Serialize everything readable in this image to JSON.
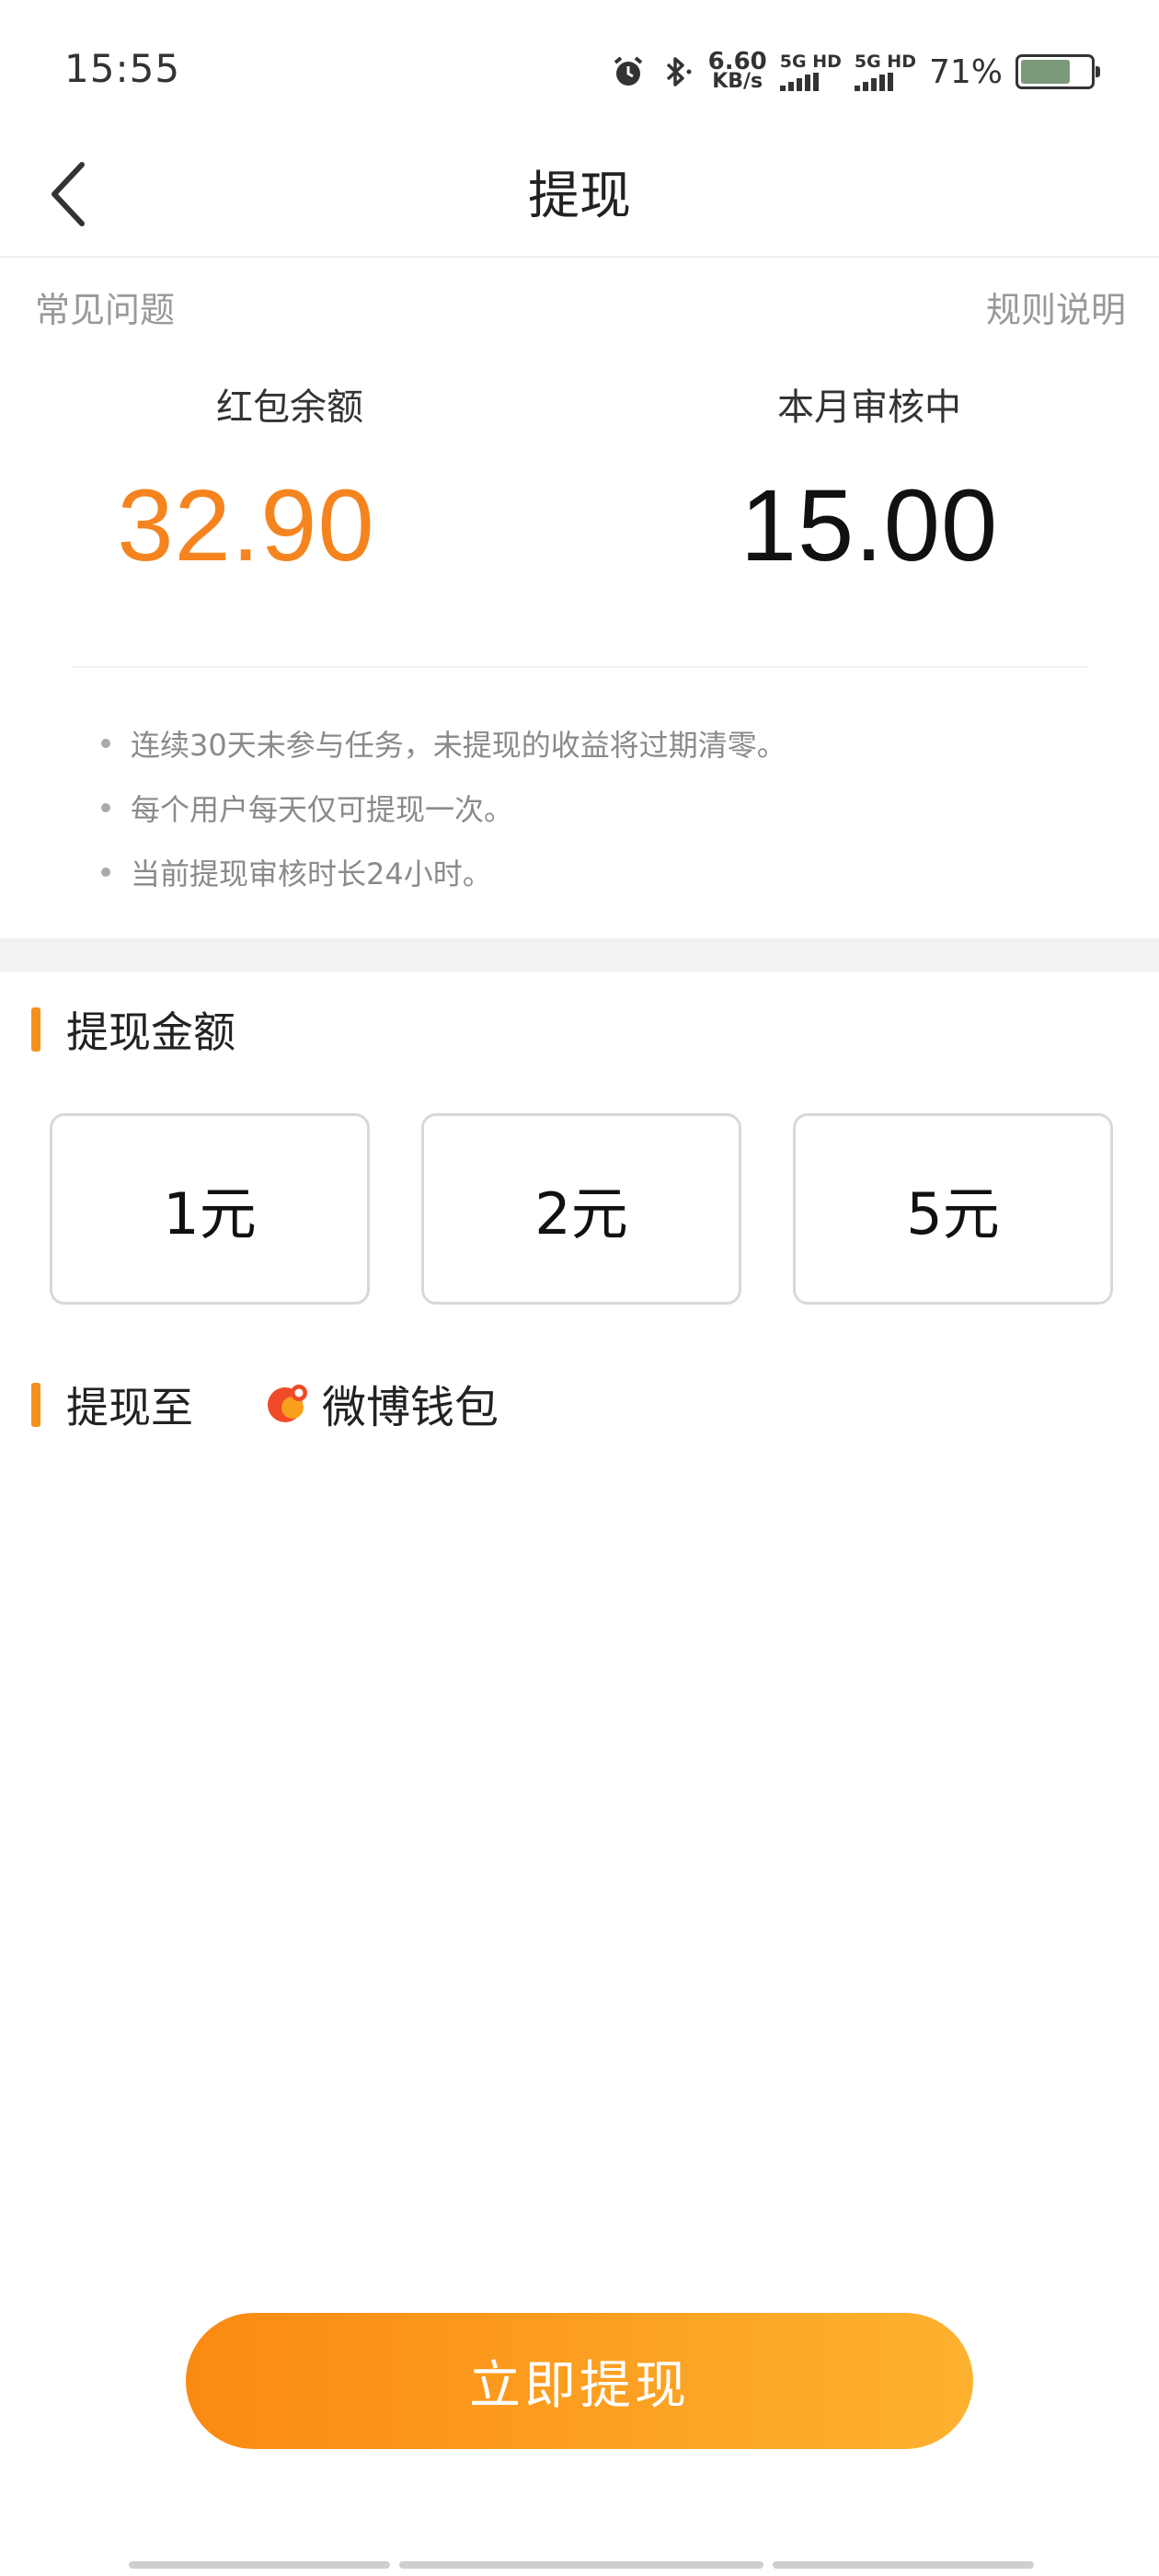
{
  "status_bar": {
    "time": "15:55",
    "net_speed_value": "6.60",
    "net_speed_unit": "KB/s",
    "sim1": "5G HD",
    "sim2": "5G HD",
    "battery_percent": "71%",
    "battery_level": 0.71
  },
  "nav": {
    "title": "提现"
  },
  "links": {
    "faq": "常见问题",
    "rules": "规则说明"
  },
  "balances": {
    "red_packet_label": "红包余额",
    "red_packet_value": "32.90",
    "reviewing_label": "本月审核中",
    "reviewing_value": "15.00"
  },
  "notes": [
    "连续30天未参与任务，未提现的收益将过期清零。",
    "每个用户每天仅可提现一次。",
    "当前提现审核时长24小时。"
  ],
  "amount_section": {
    "title": "提现金额",
    "options": [
      "1元",
      "2元",
      "5元"
    ]
  },
  "withdraw_to": {
    "title": "提现至",
    "wallet": "微博钱包"
  },
  "submit_label": "立即提现",
  "colors": {
    "accent": "#f5841f",
    "button_start": "#fb8a12",
    "button_end": "#fdb22f"
  }
}
